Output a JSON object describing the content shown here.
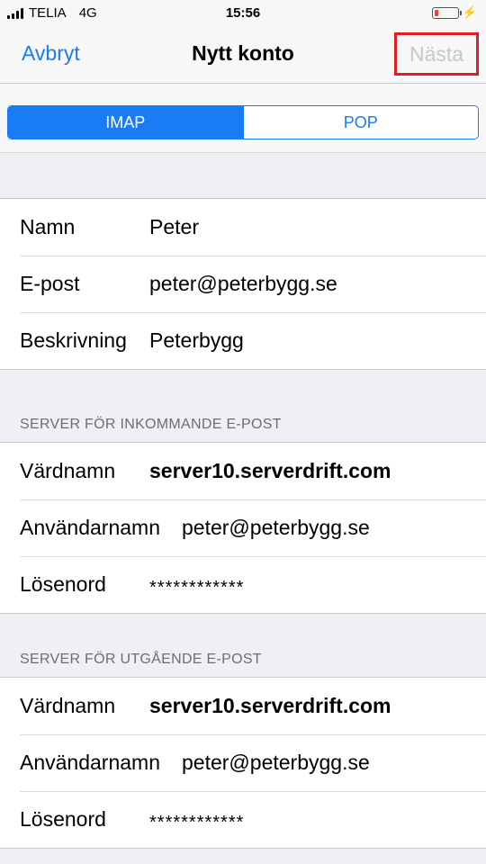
{
  "status_bar": {
    "carrier": "TELIA",
    "network": "4G",
    "time": "15:56",
    "battery_level": 0.15,
    "battery_color": "#ff3b30"
  },
  "nav": {
    "cancel": "Avbryt",
    "title": "Nytt konto",
    "next": "Nästa",
    "accent": "#1a7cf5",
    "highlight_color": "#e01c24"
  },
  "segment": {
    "options": [
      "IMAP",
      "POP"
    ],
    "selected": "IMAP"
  },
  "account": {
    "name_label": "Namn",
    "name_value": "Peter",
    "email_label": "E-post",
    "email_value": "peter@peterbygg.se",
    "desc_label": "Beskrivning",
    "desc_value": "Peterbygg"
  },
  "incoming": {
    "header": "SERVER FÖR INKOMMANDE E-POST",
    "host_label": "Värdnamn",
    "host_value": "server10.serverdrift.com",
    "user_label": "Användarnamn",
    "user_value": "peter@peterbygg.se",
    "pass_label": "Lösenord",
    "pass_value": "************"
  },
  "outgoing": {
    "header": "SERVER FÖR UTGÅENDE E-POST",
    "host_label": "Värdnamn",
    "host_value": "server10.serverdrift.com",
    "user_label": "Användarnamn",
    "user_value": "peter@peterbygg.se",
    "pass_label": "Lösenord",
    "pass_value": "************"
  }
}
